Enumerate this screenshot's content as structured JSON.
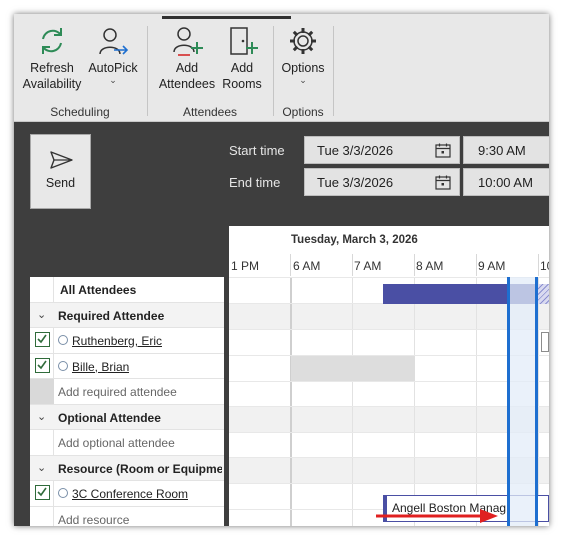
{
  "ribbon": {
    "groups": [
      {
        "label": "Scheduling"
      },
      {
        "label": "Attendees"
      },
      {
        "label": "Options"
      }
    ],
    "buttons": {
      "refresh": {
        "line1": "Refresh",
        "line2": "Availability",
        "icon": "refresh-icon"
      },
      "autopick": {
        "line1": "AutoPick",
        "line2": "⌄",
        "icon": "autopick-icon"
      },
      "add_attendees": {
        "line1": "Add",
        "line2": "Attendees",
        "icon": "add-person-icon"
      },
      "add_rooms": {
        "line1": "Add",
        "line2": "Rooms",
        "icon": "add-room-icon"
      },
      "options": {
        "line1": "Options",
        "line2": "⌄",
        "icon": "gear-icon"
      }
    }
  },
  "send": {
    "label": "Send",
    "icon": "send-icon"
  },
  "meeting_time": {
    "start_label": "Start time",
    "end_label": "End time",
    "start_date": "Tue 3/3/2026",
    "start_time": "9:30 AM",
    "end_date": "Tue 3/3/2026",
    "end_time": "10:00 AM"
  },
  "schedule": {
    "date_header": "Tuesday, March 3, 2026",
    "hours": [
      "1 PM",
      "6 AM",
      "7 AM",
      "8 AM",
      "9 AM",
      "10"
    ],
    "event_text": "Angell Boston Manag"
  },
  "attendees": {
    "all_label": "All Attendees",
    "required_header": "Required Attendee",
    "required": [
      "Ruthenberg, Eric",
      "Bille, Brian"
    ],
    "add_required": "Add required attendee",
    "optional_header": "Optional Attendee",
    "add_optional": "Add optional attendee",
    "resource_header": "Resource (Room or Equipme...",
    "resources": [
      "3C Conference Room"
    ],
    "add_resource": "Add resource"
  },
  "colors": {
    "busy": "#4a4fa4",
    "selection": "#1e6fd0",
    "arrow": "#e02020",
    "checkbox": "#2f6b3a"
  }
}
